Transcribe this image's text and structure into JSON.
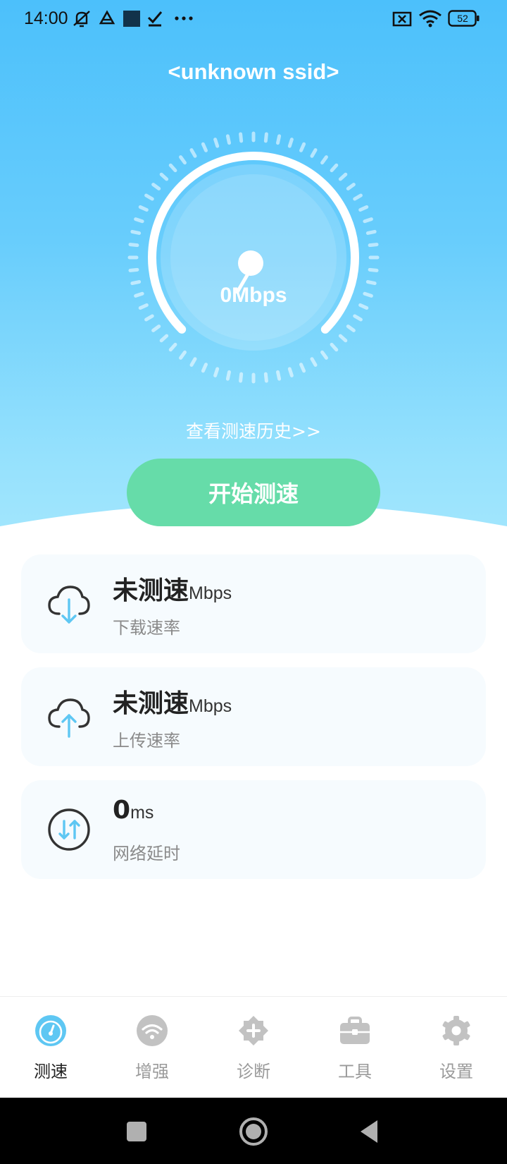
{
  "status_bar": {
    "time": "14:00",
    "battery": "52",
    "icons": [
      "mute-vibrate-icon",
      "drive-icon",
      "square-app-icon",
      "check-icon",
      "more-icon",
      "sim-x-icon",
      "wifi-icon",
      "battery-icon"
    ]
  },
  "header": {
    "ssid": "<unknown ssid>"
  },
  "gauge": {
    "speed_value": "0",
    "speed_unit": "Mbps"
  },
  "history_link": "查看测速历史>>",
  "start_button": "开始测速",
  "stats": [
    {
      "value": "未测速",
      "unit": "Mbps",
      "label": "下载速率",
      "icon": "cloud-download-icon"
    },
    {
      "value": "未测速",
      "unit": "Mbps",
      "label": "上传速率",
      "icon": "cloud-upload-icon"
    },
    {
      "value": "0",
      "unit": "ms",
      "label": "网络延时",
      "icon": "latency-icon"
    }
  ],
  "tabs": [
    {
      "label": "测速",
      "icon": "speedometer-icon",
      "active": true
    },
    {
      "label": "增强",
      "icon": "wifi-boost-icon",
      "active": false
    },
    {
      "label": "诊断",
      "icon": "diagnose-icon",
      "active": false
    },
    {
      "label": "工具",
      "icon": "toolbox-icon",
      "active": false
    },
    {
      "label": "设置",
      "icon": "gear-icon",
      "active": false
    }
  ],
  "colors": {
    "accent_blue": "#4cc0fb",
    "start_green": "#66dca9",
    "icon_blue": "#5ec7f3",
    "tab_inactive": "#c2c2c2"
  }
}
